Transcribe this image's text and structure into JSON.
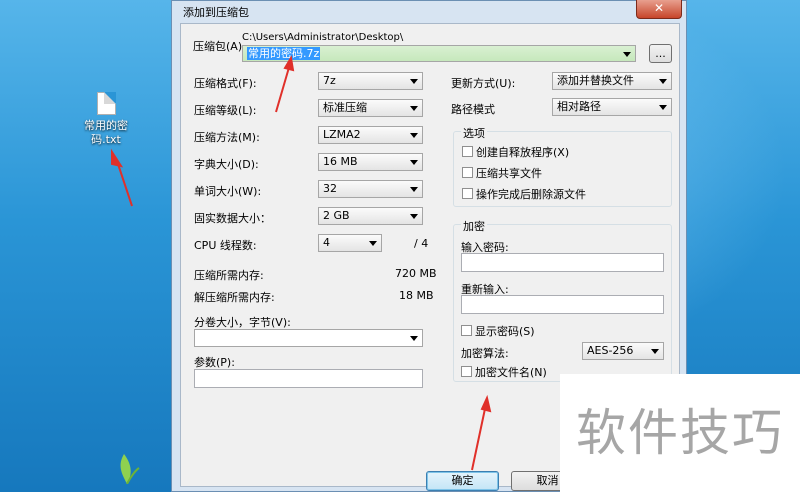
{
  "desktop": {
    "file_icon_label": "常用的密码.txt"
  },
  "dialog": {
    "title": "添加到压缩包",
    "close_symbol": "✕",
    "archive": {
      "label": "压缩包(A)",
      "path": "C:\\Users\\Administrator\\Desktop\\",
      "filename": "常用的密码.7z",
      "browse_label": "..."
    },
    "left": {
      "format_label": "压缩格式(F):",
      "format_value": "7z",
      "level_label": "压缩等级(L):",
      "level_value": "标准压缩",
      "method_label": "压缩方法(M):",
      "method_value": "LZMA2",
      "dict_label": "字典大小(D):",
      "dict_value": "16 MB",
      "word_label": "单词大小(W):",
      "word_value": "32",
      "solid_label": "固实数据大小：",
      "solid_value": "2 GB",
      "cpu_label": "CPU 线程数:",
      "cpu_value": "4",
      "cpu_total": "/ 4",
      "mem_comp_label": "压缩所需内存:",
      "mem_comp_value": "720 MB",
      "mem_decomp_label": "解压缩所需内存:",
      "mem_decomp_value": "18 MB",
      "split_label": "分卷大小，字节(V):",
      "split_value": "",
      "params_label": "参数(P):",
      "params_value": ""
    },
    "right": {
      "update_label": "更新方式(U):",
      "update_value": "添加并替换文件",
      "path_label": "路径模式",
      "path_value": "相对路径",
      "options_title": "选项",
      "opt_sfx": "创建自释放程序(X)",
      "opt_shared": "压缩共享文件",
      "opt_delete": "操作完成后删除源文件",
      "encrypt_title": "加密",
      "pwd_label": "输入密码:",
      "pwd_value": "",
      "repwd_label": "重新输入:",
      "repwd_value": "",
      "show_pwd": "显示密码(S)",
      "enc_method_label": "加密算法:",
      "enc_method_value": "AES-256",
      "enc_names": "加密文件名(N)"
    },
    "buttons": {
      "ok": "确定",
      "cancel": "取消"
    }
  },
  "watermark": "软件技巧",
  "colors": {
    "annotation_arrow": "#e0302a",
    "selection": "#3399ff"
  }
}
